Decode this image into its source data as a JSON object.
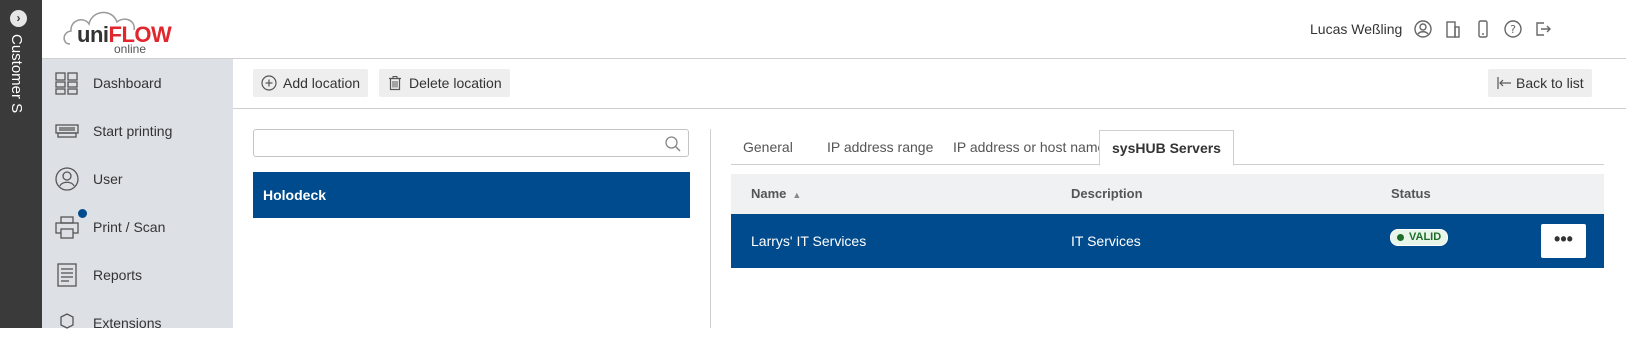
{
  "sidebar_strip": {
    "label": "Customer S"
  },
  "header": {
    "logo": {
      "uni": "uni",
      "flow": "FLOW",
      "online": "online"
    },
    "user_name": "Lucas Weßling",
    "icons": [
      "user-circle-icon",
      "building-icon",
      "phone-icon",
      "help-icon",
      "logout-icon"
    ]
  },
  "sidebar": {
    "items": [
      {
        "label": "Dashboard",
        "icon": "dashboard-icon"
      },
      {
        "label": "Start printing",
        "icon": "printer-tray-icon"
      },
      {
        "label": "User",
        "icon": "user-icon"
      },
      {
        "label": "Print / Scan",
        "icon": "printer-icon",
        "badge_color": "#004b8d"
      },
      {
        "label": "Reports",
        "icon": "report-icon"
      },
      {
        "label": "Extensions",
        "icon": "extension-icon"
      }
    ]
  },
  "toolbar": {
    "add_label": "Add location",
    "delete_label": "Delete location",
    "back_label": "Back to list"
  },
  "search": {
    "placeholder": ""
  },
  "locations": [
    {
      "name": "Holodeck"
    }
  ],
  "tabs": [
    {
      "label": "General",
      "active": false
    },
    {
      "label": "IP address range",
      "active": false
    },
    {
      "label": "IP address or host name",
      "active": false
    },
    {
      "label": "sysHUB Servers",
      "active": true
    }
  ],
  "table": {
    "columns": [
      "Name",
      "Description",
      "Status"
    ],
    "rows": [
      {
        "name": "Larrys' IT Services",
        "description": "IT Services",
        "status": "VALID",
        "actions": "•••"
      }
    ]
  },
  "colors": {
    "accent": "#004b8d",
    "brand_red": "#e1262d",
    "sidebar_bg": "#dde1e6",
    "valid": "#1e6e2a"
  }
}
